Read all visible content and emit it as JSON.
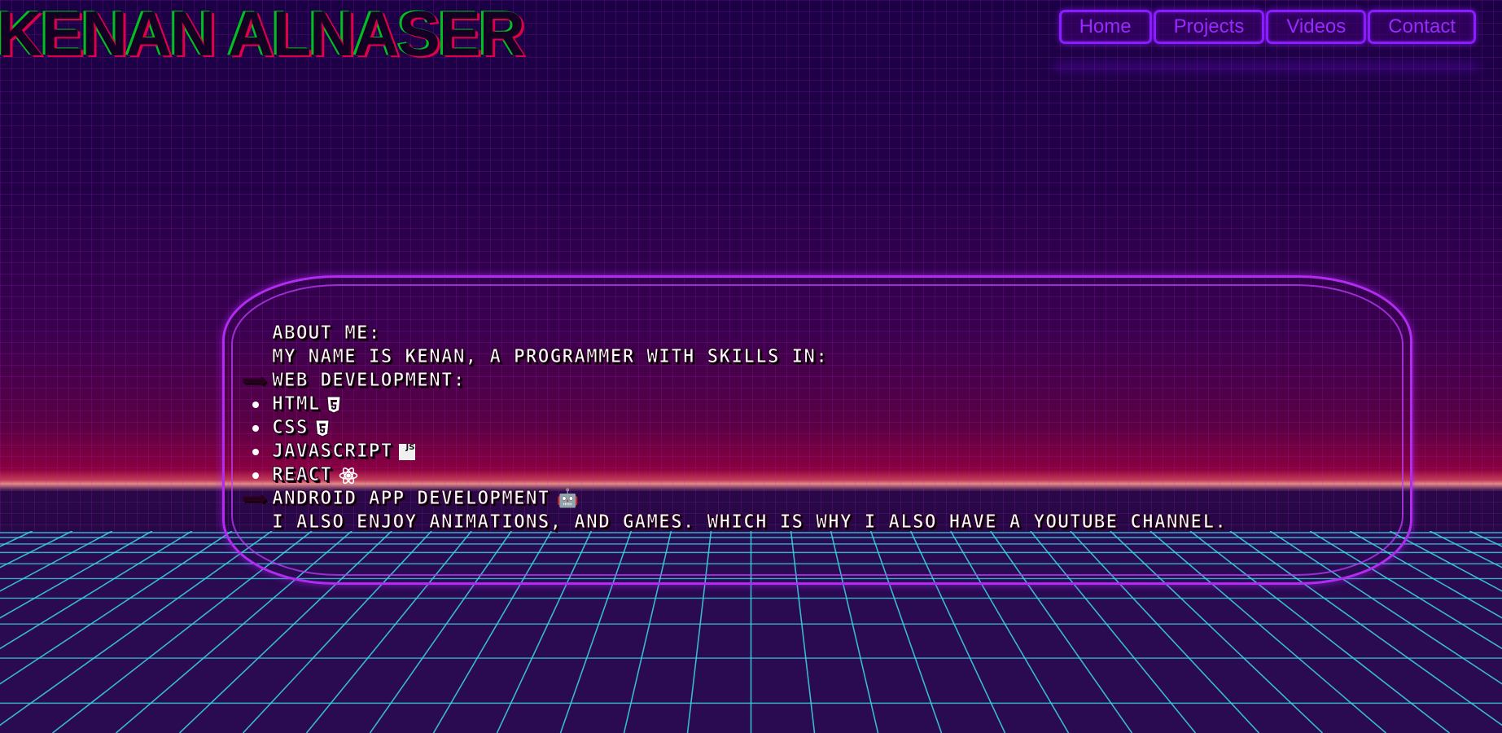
{
  "header": {
    "title": "KENAN ALNASER"
  },
  "nav": {
    "items": [
      {
        "label": "Home"
      },
      {
        "label": "Projects"
      },
      {
        "label": "Videos"
      },
      {
        "label": "Contact"
      }
    ]
  },
  "about": {
    "heading": "ABOUT ME:",
    "intro": "MY NAME IS KENAN, A PROGRAMMER WITH SKILLS IN:",
    "web_dev": {
      "arrow": "⟹",
      "label": "WEB DEVELOPMENT:"
    },
    "skills": [
      {
        "label": "HTML",
        "icon": "html5-icon"
      },
      {
        "label": "CSS",
        "icon": "css3-icon"
      },
      {
        "label": "JAVASCRIPT",
        "icon": "js-icon",
        "icon_text": "JS"
      },
      {
        "label": "REACT",
        "icon": "react-icon"
      }
    ],
    "android": {
      "arrow": "⟹",
      "label": "ANDROID APP DEVELOPMENT",
      "icon": "robot-icon",
      "icon_glyph": "🤖"
    },
    "outro": "I ALSO ENJOY ANIMATIONS, AND GAMES. WHICH IS WHY I ALSO HAVE A YOUTUBE CHANNEL."
  },
  "colors": {
    "accent": "#8a1cff",
    "card_border": "#b22cf0",
    "floor_grid": "#3ad8e6",
    "title_red": "#e0004a",
    "title_green": "#00c020"
  }
}
